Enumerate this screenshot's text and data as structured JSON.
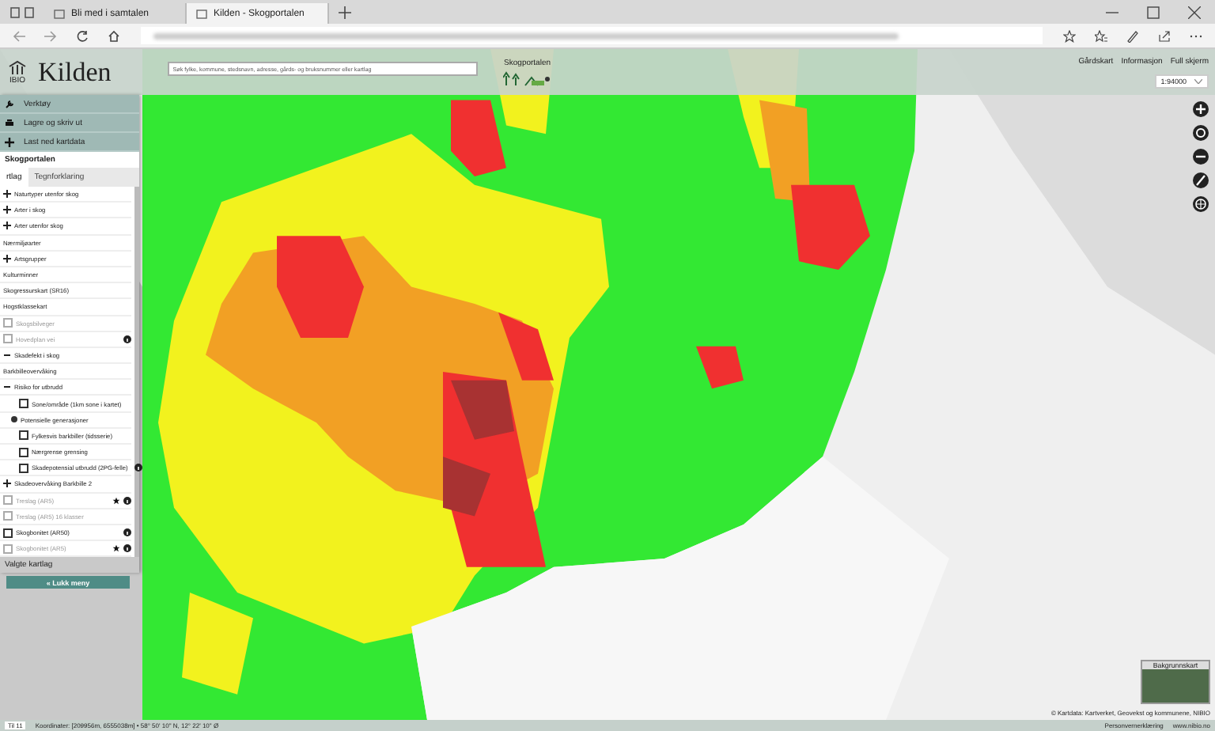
{
  "browser": {
    "tabs": [
      {
        "label": "Bli med i samtalen",
        "selected": false
      },
      {
        "label": "Kilden - Skogportalen",
        "selected": true
      }
    ]
  },
  "header": {
    "logo_org": "IBIO",
    "logo_title": "Kilden",
    "search": {
      "placeholder": "Søk fylke, kommune, stedsnavn, adresse, gårds- og bruksnummer eller kartlag"
    },
    "portal_logo": "Skogportalen",
    "links": [
      "Gårdskart",
      "Informasjon",
      "Full skjerm"
    ],
    "scale": "1:94000"
  },
  "menu": [
    {
      "label": "Verktøy"
    },
    {
      "label": "Lagre og skriv ut"
    },
    {
      "label": "Last ned kartdata"
    }
  ],
  "panel": {
    "title": "Skogportalen",
    "tabs": [
      {
        "label": "rtlag",
        "selected": true
      },
      {
        "label": "Tegnforklaring",
        "selected": false
      }
    ],
    "layers": [
      {
        "kind": "group",
        "label": "Naturtyper utenfor skog",
        "expanded": false
      },
      {
        "kind": "group",
        "label": "Arter i skog",
        "expanded": false
      },
      {
        "kind": "group",
        "label": "Arter utenfor skog",
        "expanded": false
      },
      {
        "kind": "label",
        "label": "Nærmiljøarter"
      },
      {
        "kind": "group",
        "label": "Artsgrupper",
        "expanded": false
      },
      {
        "kind": "label",
        "label": "Kulturminner"
      },
      {
        "kind": "label",
        "label": "Skogressurskart (SR16)"
      },
      {
        "kind": "label",
        "label": "Hogstklassekart"
      },
      {
        "kind": "checkbox",
        "label": "Skogsbilveger",
        "checked": false,
        "disabled": true
      },
      {
        "kind": "checkbox",
        "label": "Hovedplan vei",
        "checked": false,
        "disabled": true,
        "info": true
      },
      {
        "kind": "group",
        "label": "Skadefekt i skog",
        "expanded": true
      },
      {
        "kind": "label",
        "label": "Barkbilleovervåking"
      },
      {
        "kind": "group",
        "label": "Risiko for utbrudd",
        "expanded": true,
        "children": [
          {
            "kind": "checkbox",
            "label": "Sone/område (1km sone i kartet)",
            "checked": false,
            "disabled": false,
            "nested": true
          },
          {
            "kind": "radio",
            "label": "Potensielle generasjoner",
            "selected": true
          },
          {
            "kind": "checkbox",
            "label": "Fylkesvis barkbiller (tidsserie)",
            "checked": false,
            "disabled": false,
            "nested": true
          },
          {
            "kind": "checkbox",
            "label": "Nærgrense grensing",
            "checked": false,
            "disabled": false,
            "nested": true
          },
          {
            "kind": "checkbox",
            "label": "Skadepotensial utbrudd (2PG-felle)",
            "checked": false,
            "disabled": false,
            "nested": true,
            "info": true
          }
        ]
      },
      {
        "kind": "group",
        "label": "Skadeovervåking Barkbille 2",
        "expanded": false
      },
      {
        "kind": "checkbox",
        "label": "Treslag (AR5)",
        "checked": false,
        "disabled": true,
        "star": true,
        "info": true
      },
      {
        "kind": "checkbox",
        "label": "Treslag (AR5) 16 klasser",
        "checked": false,
        "disabled": true
      },
      {
        "kind": "checkbox",
        "label": "Skogbonitet (AR50)",
        "checked": false,
        "disabled": false,
        "info": true
      },
      {
        "kind": "checkbox",
        "label": "Skogbonitet (AR5)",
        "checked": false,
        "disabled": true,
        "star": true,
        "info": true
      }
    ],
    "selected_layers": "Valgte kartlag",
    "close_button": "« Lukk meny"
  },
  "basemap": {
    "label": "Bakgrunnskart"
  },
  "attribution": "© Kartdata: Kartverket, Geovekst og kommunene, NIBIO",
  "status_bar": {
    "zoom": "Til 11",
    "coordinates": "Koordinater: [209956m, 6555038m]  •  58° 50' 10\" N, 12° 22' 10\" Ø",
    "links": [
      "Personvernerklæring",
      "www.nibio.no"
    ]
  }
}
